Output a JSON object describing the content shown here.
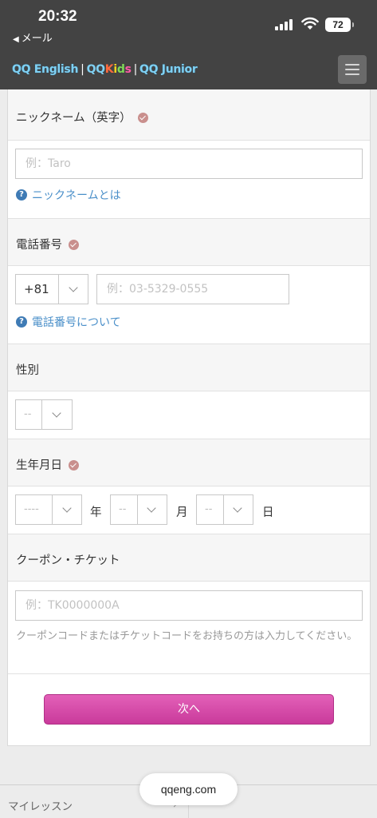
{
  "status_bar": {
    "time": "20:32",
    "back_label": "メール",
    "battery": "72"
  },
  "header": {
    "logo_qq_english": "QQ English",
    "logo_qq": "QQ",
    "logo_kids": [
      "K",
      "i",
      "d",
      "s"
    ],
    "logo_qq_junior": "QQ Junior",
    "separator": "|"
  },
  "form": {
    "nickname": {
      "label": "ニックネーム（英字）",
      "placeholder": "例：Taro",
      "help": "ニックネームとは"
    },
    "phone": {
      "label": "電話番号",
      "country_code": "+81",
      "placeholder": "例：03-5329-0555",
      "help": "電話番号について"
    },
    "gender": {
      "label": "性別",
      "value": "--"
    },
    "birthday": {
      "label": "生年月日",
      "year_value": "----",
      "year_unit": "年",
      "month_value": "--",
      "month_unit": "月",
      "day_value": "--",
      "day_unit": "日"
    },
    "coupon": {
      "label": "クーポン・チケット",
      "placeholder": "例：TK0000000A",
      "note": "クーポンコードまたはチケットコードをお持ちの方は入力してください。"
    },
    "next_button": "次へ"
  },
  "bottom": {
    "link": "マイレッスン",
    "url": "qqeng.com"
  },
  "colors": {
    "header_bg": "#434343",
    "accent_pink": "#d94aac",
    "link_blue": "#4a8fc9",
    "required_check": "#c98f8d"
  }
}
